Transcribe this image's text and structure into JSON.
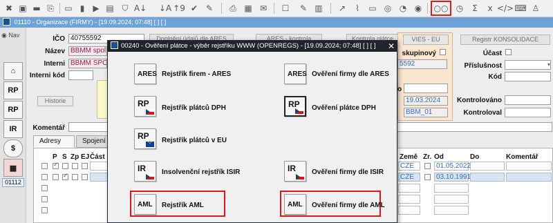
{
  "toolbar": {
    "icons": [
      "close-icon",
      "save-icon",
      "delete-icon",
      "copy-icon",
      "record-icon",
      "list-icon",
      "filter-icon",
      "sort-alpha-icon",
      "sort-numeric-icon",
      "check-icon",
      "edit-icon",
      "print-icon",
      "preview-icon",
      "mail-icon",
      "form-icon",
      "note-icon",
      "stats-icon",
      "link-icon",
      "attach-icon",
      "layout-icon",
      "globe-icon",
      "pie-icon",
      "eye-icon",
      "glasses-icon",
      "clock-icon",
      "sum-icon",
      "excel-icon",
      "code-icon",
      "keyboard-icon",
      "person-icon"
    ]
  },
  "window": {
    "title": "01110 - Organizace (FIRMY) - [19.09.2024; 07:48]  [ ]  [ ]"
  },
  "left": {
    "nav_label": "Nav",
    "record_number": "01112"
  },
  "form": {
    "ico_label": "IČO",
    "ico_value": "40755592",
    "nazev_label": "Název",
    "nazev_value": "BBMM spol. s",
    "interni_label": "Interni",
    "interni_value": "BBMM SPOL.",
    "interni_kod_label": "Interni kód",
    "historie_button": "Historie",
    "komentar_label": "Komentář",
    "btn_doplneni": "Doplnění údajů dle ARES",
    "btn_ares_kontrola": "ARES - kontrola",
    "btn_kontrola_platce": "Kontrola plátce",
    "vies_label": "VIES - EU",
    "registr_label": "Registr KONSOLIDACE",
    "skupinovy_label": "skupinový",
    "dic_value": "5592",
    "date_label_suffix": "o",
    "date_value": "19.03.2024",
    "user_label_suffix": "il",
    "user_value": "BBM_01",
    "ucast_label": "Účast",
    "prislusnost_label": "Příslušnost",
    "kod_label": "Kód",
    "kontrolovano_label": "Kontrolováno",
    "kontroloval_label": "Kontroloval"
  },
  "tabs": [
    {
      "label": "Adresy"
    },
    {
      "label": "Spojení"
    }
  ],
  "grid": {
    "headers": [
      "P",
      "S",
      "Zp",
      "EJ",
      "Část",
      "Země",
      "Zr.",
      "Od",
      "Do",
      "Komentář"
    ],
    "rows": [
      {
        "zeme": "CZE",
        "od": "01.05.2022"
      },
      {
        "zeme": "CZE",
        "od": "03.10.1991"
      }
    ]
  },
  "dialog": {
    "title": "00240 - Ověření plátce - výběr rejstříku WWW (OPENREGS) - [19.09.2024; 07:48]  [ ]  [ ]",
    "items": [
      {
        "icon": "ARES",
        "label": "Rejstřík firem - ARES"
      },
      {
        "icon": "ARES",
        "label": "Ověření firmy dle ARES"
      },
      {
        "icon": "RP",
        "label": "Rejstřík plátců DPH"
      },
      {
        "icon": "RP",
        "label": "Ověření plátce DPH"
      },
      {
        "icon": "RP",
        "label": "Rejstřík plátců v EU"
      },
      {
        "icon": "IR",
        "label": "Insolvenční rejstřík ISIR"
      },
      {
        "icon": "IR",
        "label": "Ověření firmy dle ISIR"
      },
      {
        "icon": "AML",
        "label": "Rejstřík AML"
      },
      {
        "icon": "AML",
        "label": "Ověření firmy dle AML"
      }
    ]
  },
  "colors": {
    "highlight": "#e01515",
    "title_bar": "#6fa2d8",
    "dialog_title": "#20242c"
  }
}
